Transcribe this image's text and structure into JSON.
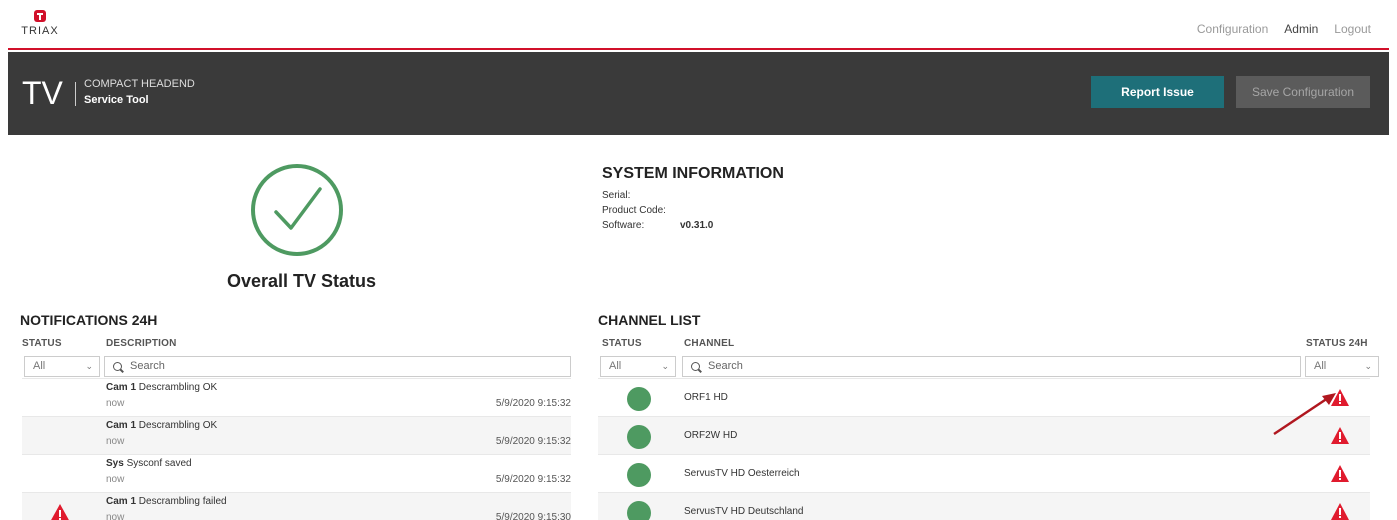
{
  "brand": {
    "logo_text": "TRIAX"
  },
  "topnav": {
    "configuration": "Configuration",
    "admin": "Admin",
    "logout": "Logout"
  },
  "header": {
    "tv": "TV",
    "subtitle": "COMPACT HEADEND",
    "title": "Service Tool",
    "report_button": "Report Issue",
    "save_button": "Save Configuration"
  },
  "overall": {
    "label": "Overall TV Status",
    "icon": "check-circle-icon",
    "color": "#4e9a61"
  },
  "system_info": {
    "title": "SYSTEM INFORMATION",
    "serial_label": "Serial:",
    "serial_value": "",
    "product_code_label": "Product Code:",
    "product_code_value": "",
    "software_label": "Software:",
    "software_value": "v0.31.0"
  },
  "notifications": {
    "title": "NOTIFICATIONS 24H",
    "col_status": "STATUS",
    "col_description": "DESCRIPTION",
    "filter_value": "All",
    "search_placeholder": "Search",
    "items": [
      {
        "source": "Cam 1",
        "text": "Descrambling OK",
        "ago": "now",
        "timestamp": "5/9/2020 9:15:32",
        "status": "none"
      },
      {
        "source": "Cam 1",
        "text": "Descrambling OK",
        "ago": "now",
        "timestamp": "5/9/2020 9:15:32",
        "status": "none"
      },
      {
        "source": "Sys",
        "text": "Sysconf saved",
        "ago": "now",
        "timestamp": "5/9/2020 9:15:32",
        "status": "none"
      },
      {
        "source": "Cam 1",
        "text": "Descrambling failed",
        "ago": "now",
        "timestamp": "5/9/2020 9:15:30",
        "status": "warning"
      }
    ]
  },
  "channels": {
    "title": "CHANNEL LIST",
    "col_status": "STATUS",
    "col_channel": "CHANNEL",
    "col_status24": "STATUS 24H",
    "filter_value": "All",
    "filter24_value": "All",
    "search_placeholder": "Search",
    "items": [
      {
        "name": "ORF1 HD",
        "status": "ok",
        "status24": "warning"
      },
      {
        "name": "ORF2W HD",
        "status": "ok",
        "status24": "warning"
      },
      {
        "name": "ServusTV HD Oesterreich",
        "status": "ok",
        "status24": "warning"
      },
      {
        "name": "ServusTV HD Deutschland",
        "status": "ok",
        "status24": "warning"
      }
    ]
  },
  "colors": {
    "accent_red": "#d1102a",
    "teal": "#1e6f79",
    "ok_green": "#4e9a61",
    "warn_red": "#e01b2e"
  }
}
